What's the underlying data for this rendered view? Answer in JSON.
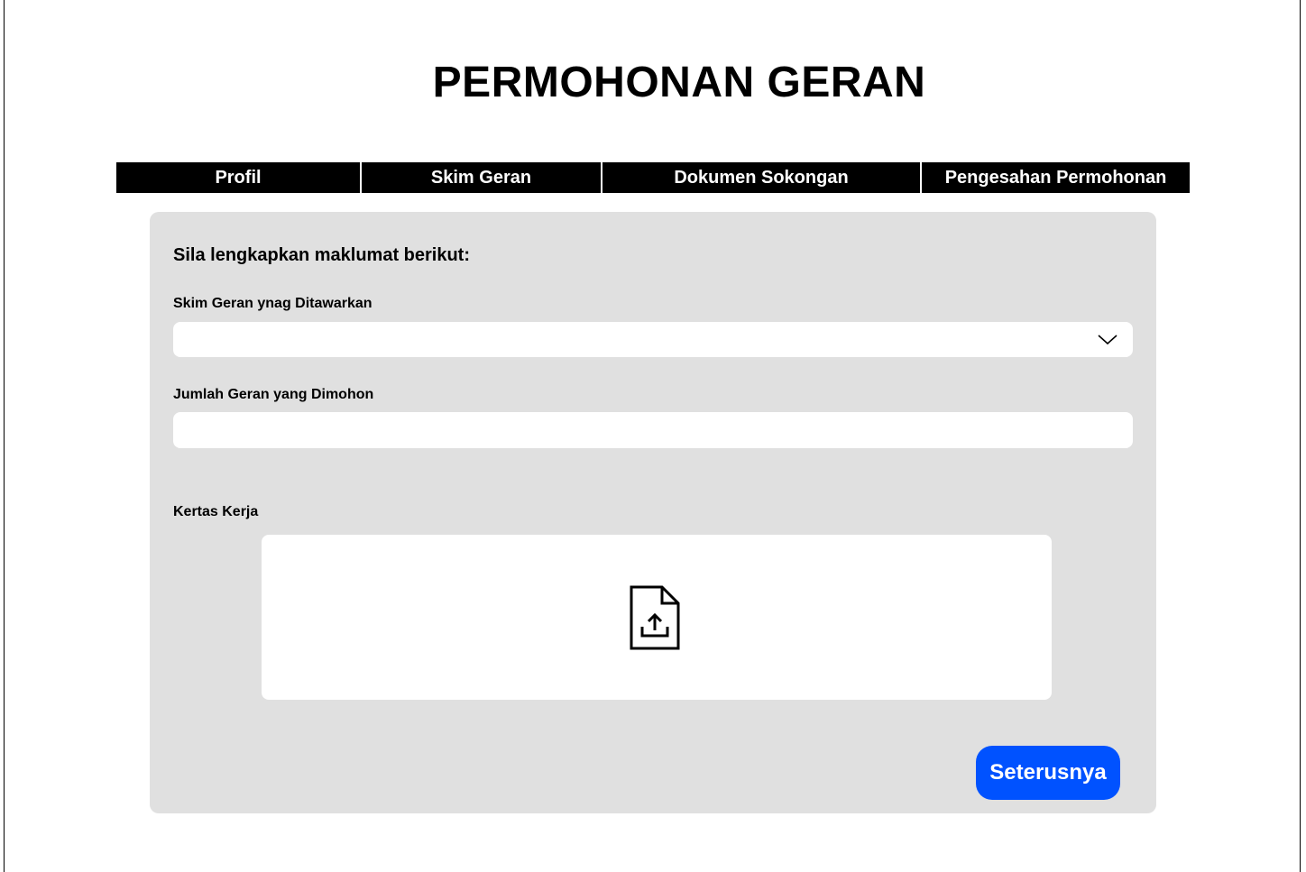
{
  "page": {
    "title": "PERMOHONAN GERAN"
  },
  "tabs": [
    {
      "label": "Profil"
    },
    {
      "label": "Skim Geran"
    },
    {
      "label": "Dokumen Sokongan"
    },
    {
      "label": "Pengesahan Permohonan"
    }
  ],
  "form": {
    "instructions": "Sila lengkapkan maklumat berikut:",
    "skim_field": {
      "label": "Skim Geran ynag Ditawarkan",
      "value": ""
    },
    "jumlah_field": {
      "label": "Jumlah Geran yang Dimohon",
      "value": "",
      "placeholder": ""
    },
    "kertas_field": {
      "label": "Kertas Kerja",
      "icon": "file-upload-icon"
    },
    "next_button_label": "Seterusnya"
  },
  "colors": {
    "tab_background": "#000000",
    "panel_background": "#e0e0e0",
    "primary_button": "#0052ff"
  }
}
